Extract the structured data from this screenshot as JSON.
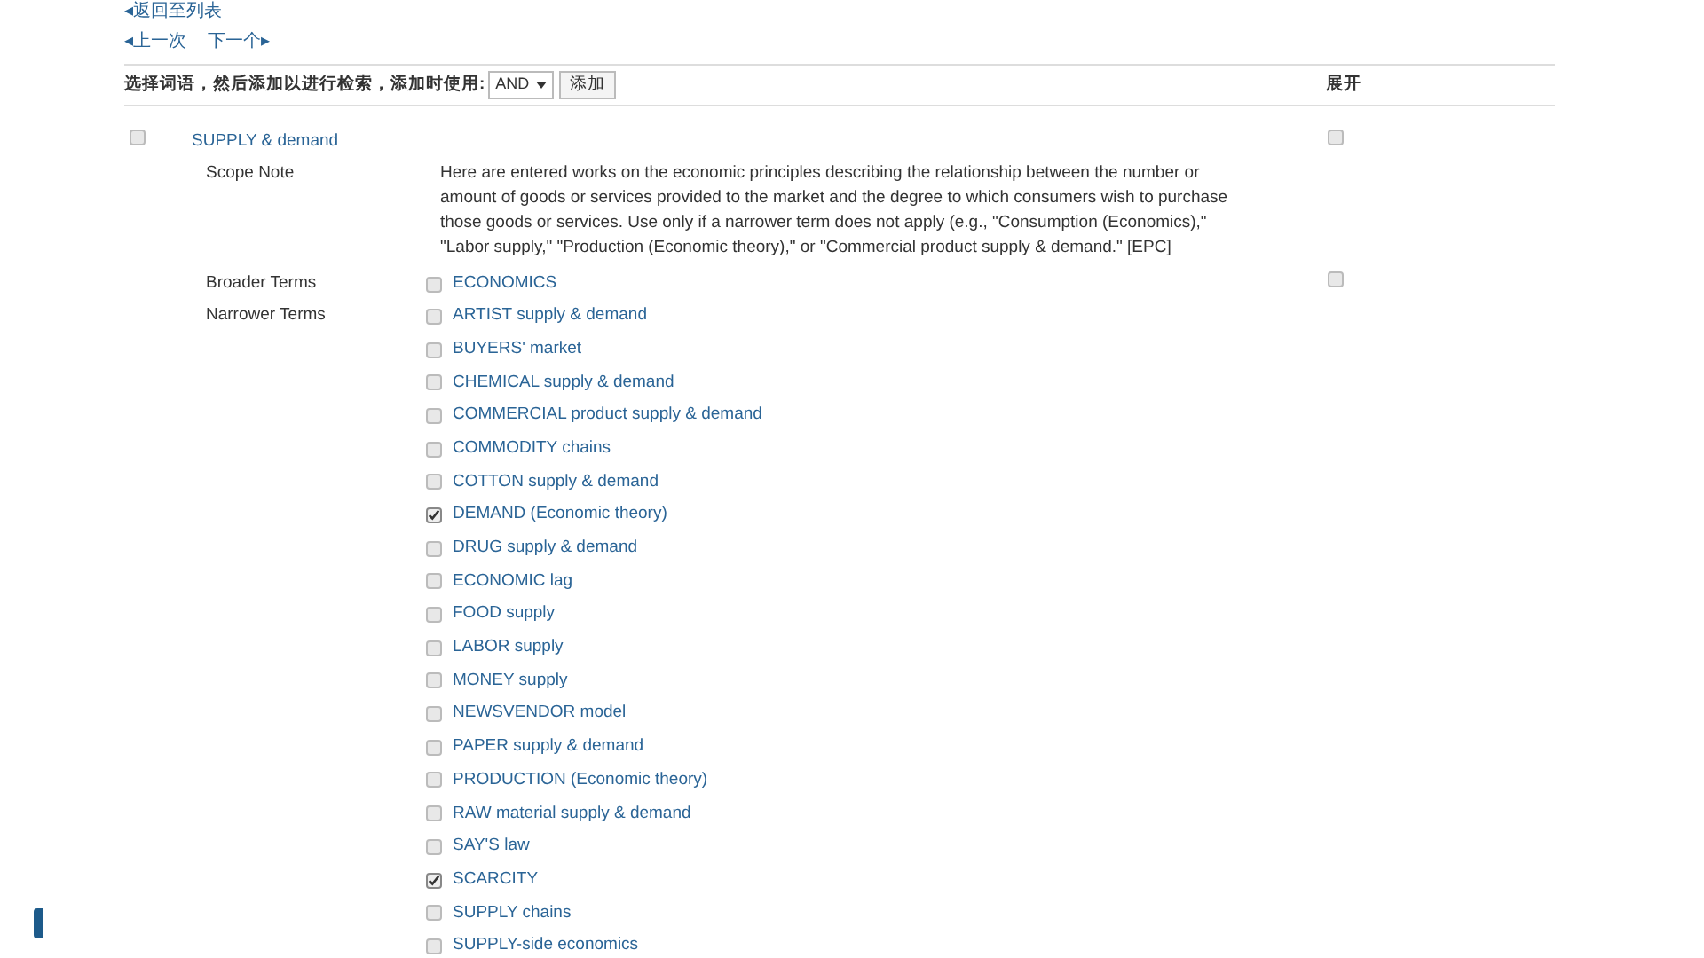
{
  "back_link": "◂返回至列表",
  "nav": [
    {
      "label": "◂上一次"
    },
    {
      "label": "下一个▸"
    }
  ],
  "toolbar": {
    "label": "选择词语，然后添加以进行检索，添加时使用:",
    "operator": "AND",
    "add_button": "添加",
    "expand_header": "展开"
  },
  "term": {
    "label": "SUPPLY & demand",
    "checked": false,
    "expand_checked": false
  },
  "scope_note": {
    "label": "Scope Note",
    "text": "Here are entered works on the economic principles describing the relationship between the number or amount of goods or services provided to the market and the degree to which consumers wish to purchase those goods or services. Use only if a narrower term does not apply (e.g., \"Consumption (Economics),\" \"Labor supply,\" \"Production (Economic theory),\" or \"Commercial product supply & demand.\" [EPC]"
  },
  "broader": {
    "label": "Broader Terms",
    "expand_checked": false,
    "terms": [
      {
        "label": "ECONOMICS",
        "checked": false
      }
    ]
  },
  "narrower": {
    "label": "Narrower Terms",
    "terms": [
      {
        "label": "ARTIST supply & demand",
        "checked": false
      },
      {
        "label": "BUYERS' market",
        "checked": false
      },
      {
        "label": "CHEMICAL supply & demand",
        "checked": false
      },
      {
        "label": "COMMERCIAL product supply & demand",
        "checked": false
      },
      {
        "label": "COMMODITY chains",
        "checked": false
      },
      {
        "label": "COTTON supply & demand",
        "checked": false
      },
      {
        "label": "DEMAND (Economic theory)",
        "checked": true
      },
      {
        "label": "DRUG supply & demand",
        "checked": false
      },
      {
        "label": "ECONOMIC lag",
        "checked": false
      },
      {
        "label": "FOOD supply",
        "checked": false
      },
      {
        "label": "LABOR supply",
        "checked": false
      },
      {
        "label": "MONEY supply",
        "checked": false
      },
      {
        "label": "NEWSVENDOR model",
        "checked": false
      },
      {
        "label": "PAPER supply & demand",
        "checked": false
      },
      {
        "label": "PRODUCTION (Economic theory)",
        "checked": false
      },
      {
        "label": "RAW material supply & demand",
        "checked": false
      },
      {
        "label": "SAY'S law",
        "checked": false
      },
      {
        "label": "SCARCITY",
        "checked": true
      },
      {
        "label": "SUPPLY chains",
        "checked": false
      },
      {
        "label": "SUPPLY-side economics",
        "checked": false
      }
    ]
  }
}
